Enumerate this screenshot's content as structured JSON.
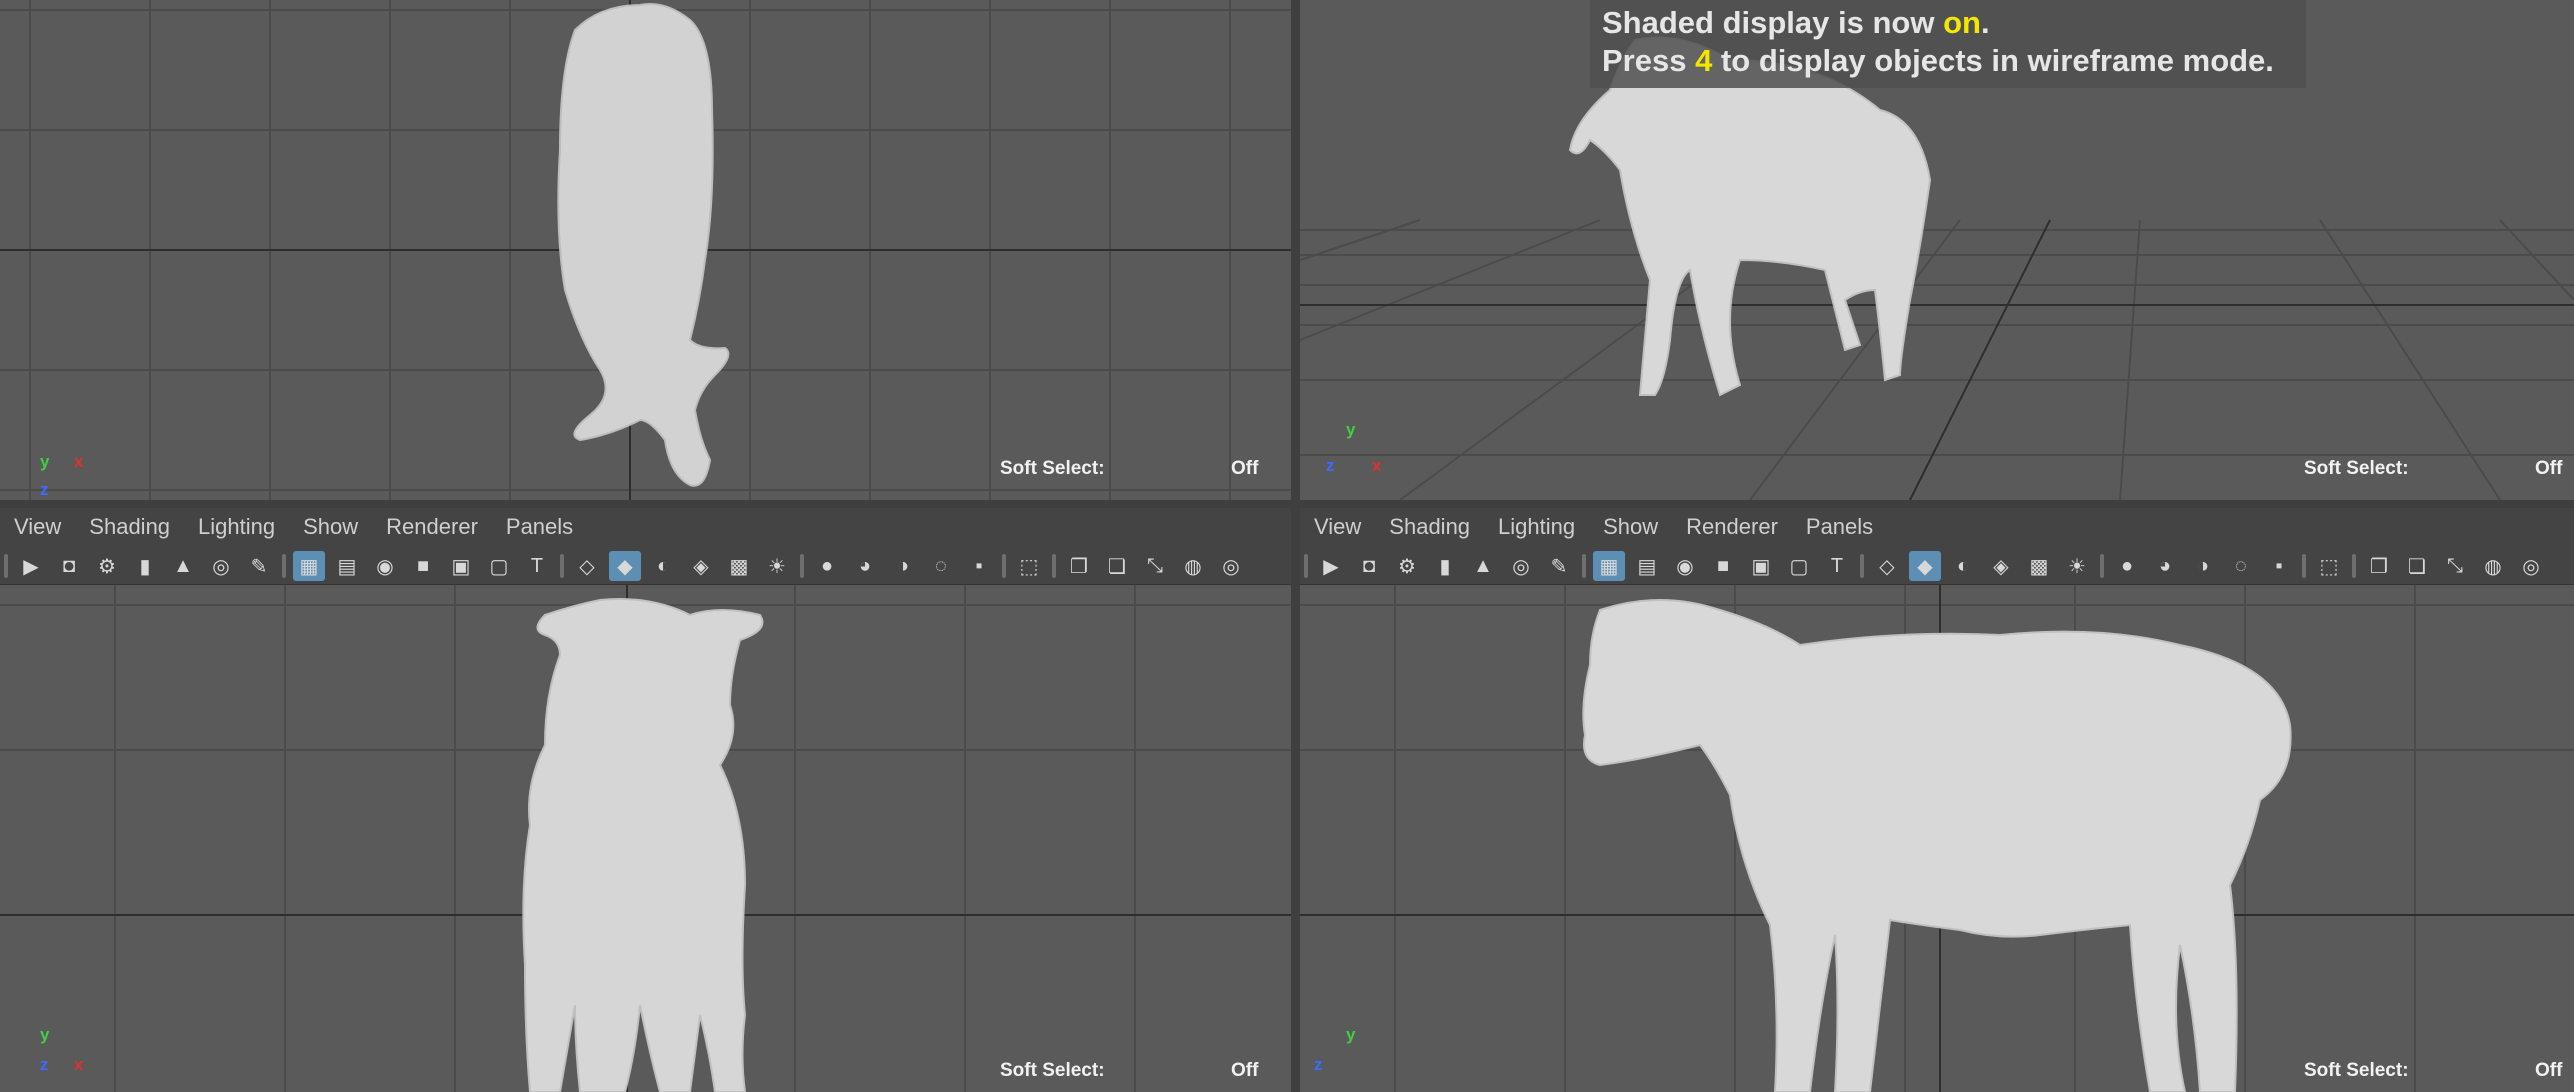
{
  "hud": {
    "line1_pre": "Shaded display is now ",
    "line1_hl": "on",
    "line1_post": ".",
    "line2_pre": "Press ",
    "line2_hl": "4",
    "line2_post": " to display objects in wireframe mode."
  },
  "viewports": {
    "top": {
      "soft_label": "Soft Select:",
      "soft_value": "Off"
    },
    "persp": {
      "soft_label": "Soft Select:",
      "soft_value": "Off"
    },
    "front": {
      "soft_label": "Soft Select:",
      "soft_value": "Off"
    },
    "side": {
      "soft_label": "Soft Select:",
      "soft_value": "Off"
    }
  },
  "menus": {
    "left": [
      "View",
      "Shading",
      "Lighting",
      "Show",
      "Renderer",
      "Panels"
    ],
    "right": [
      "View",
      "Shading",
      "Lighting",
      "Show",
      "Renderer",
      "Panels"
    ]
  },
  "axes": {
    "x": "x",
    "y": "y",
    "z": "z"
  },
  "colors": {
    "viewport_bg": "#5a5a5a",
    "grid": "#4a4a4a",
    "grid_axis": "#2e2e2e",
    "active_tool": "#5c8fb3",
    "hud_highlight": "#f5e600",
    "axis_x": "#e03030",
    "axis_y": "#40d040",
    "axis_z": "#3a6cff"
  },
  "toolbar_icons": [
    "camera-icon",
    "camera-lock-icon",
    "camera-attributes-icon",
    "bookmark-icon",
    "image-plane-icon",
    "2d-pan-zoom-icon",
    "grease-pencil-icon",
    "grid-icon",
    "film-gate-icon",
    "resolution-gate-icon",
    "gate-mask-icon",
    "field-chart-icon",
    "safe-action-icon",
    "safe-title-icon",
    "wireframe-icon",
    "smooth-shade-icon",
    "default-material-icon",
    "shaded-wireframe-icon",
    "textured-icon",
    "use-all-lights-icon",
    "shadows-icon",
    "screen-space-ao-icon",
    "motion-blur-icon",
    "anti-aliasing-icon",
    "depth-of-field-icon",
    "isolate-select-icon",
    "xray-icon",
    "xray-joints-icon",
    "xray-components-icon",
    "backface-icon",
    "camera-aperture-icon"
  ]
}
